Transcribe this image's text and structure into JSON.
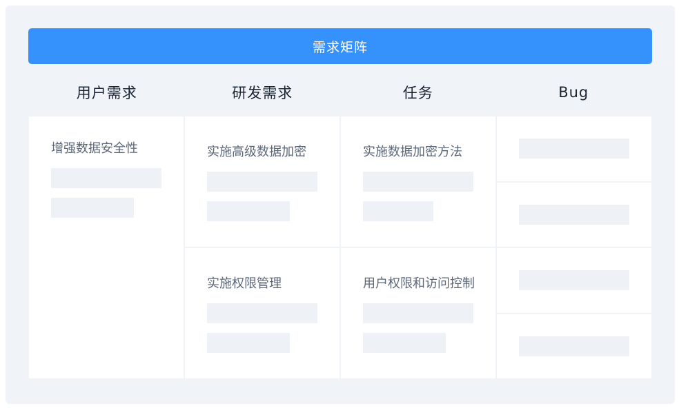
{
  "banner": {
    "title": "需求矩阵"
  },
  "columns": [
    {
      "header": "用户需求",
      "cards": [
        {
          "title": "增强数据安全性"
        }
      ]
    },
    {
      "header": "研发需求",
      "cards": [
        {
          "title": "实施高级数据加密"
        },
        {
          "title": "实施权限管理"
        }
      ]
    },
    {
      "header": "任务",
      "cards": [
        {
          "title": "实施数据加密方法"
        },
        {
          "title": "用户权限和访问控制"
        }
      ]
    },
    {
      "header": "Bug",
      "cards": [
        {},
        {},
        {},
        {}
      ]
    }
  ],
  "colors": {
    "banner": "#3592fd",
    "outer_background": "#f0f3f7",
    "card_background": "#ffffff",
    "placeholder_bar": "#eef2f6"
  }
}
